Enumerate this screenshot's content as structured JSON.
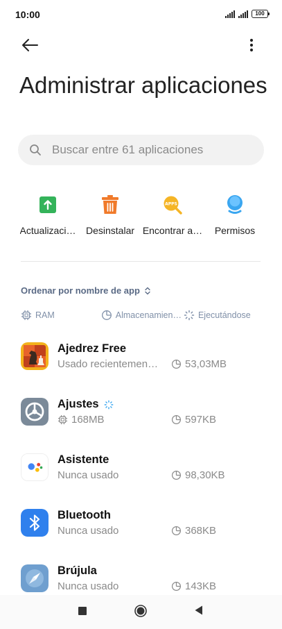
{
  "status": {
    "time": "10:00",
    "battery": "100"
  },
  "header": {
    "title": "Administrar aplicaciones"
  },
  "search": {
    "placeholder": "Buscar entre 61 aplicaciones"
  },
  "actions": [
    {
      "label": "Actualizaci…",
      "icon": "update-icon",
      "color": "#34b35a"
    },
    {
      "label": "Desinstalar",
      "icon": "trash-icon",
      "color": "#f07a2a"
    },
    {
      "label": "Encontrar a…",
      "icon": "find-apps-icon",
      "color": "#f5b526"
    },
    {
      "label": "Permisos",
      "icon": "permissions-icon",
      "color": "#3aa6f0"
    }
  ],
  "sort": {
    "label": "Ordenar por nombre de app"
  },
  "filters": {
    "ram": "RAM",
    "storage": "Almacenamien…",
    "running": "Ejecutándose"
  },
  "apps": [
    {
      "name": "Ajedrez Free",
      "status": "Usado recientemen…",
      "size": "53,03MB"
    },
    {
      "name": "Ajustes",
      "ram": "168MB",
      "size": "597KB"
    },
    {
      "name": "Asistente",
      "status": "Nunca usado",
      "size": "98,30KB"
    },
    {
      "name": "Bluetooth",
      "status": "Nunca usado",
      "size": "368KB"
    },
    {
      "name": "Brújula",
      "status": "Nunca usado",
      "size": "143KB"
    }
  ]
}
